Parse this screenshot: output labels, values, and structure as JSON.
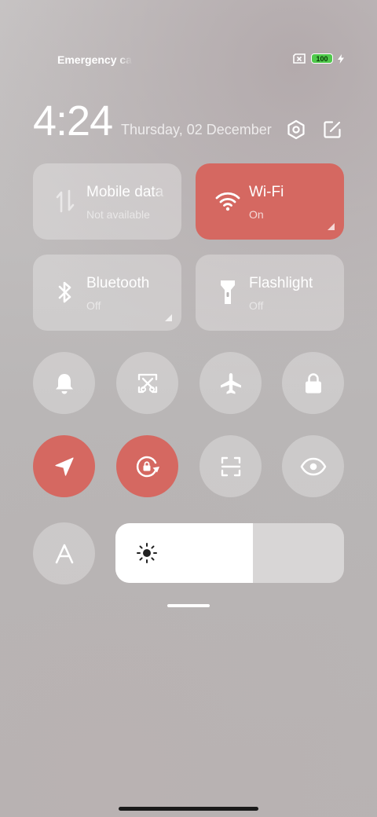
{
  "status_bar": {
    "carrier": "Emergency calls only",
    "battery_level": "100",
    "battery_color": "#4fc94b"
  },
  "header": {
    "time": "4:24",
    "date": "Thursday, 02 December"
  },
  "accent_color": "#d56861",
  "tiles": [
    {
      "label": "Mobile data",
      "status": "Not available",
      "icon": "mobile-data-icon",
      "active": false
    },
    {
      "label": "Wi-Fi",
      "status": "On",
      "icon": "wifi-icon",
      "active": true
    },
    {
      "label": "Bluetooth",
      "status": "Off",
      "icon": "bluetooth-icon",
      "active": false
    },
    {
      "label": "Flashlight",
      "status": "Off",
      "icon": "flashlight-icon",
      "active": false
    }
  ],
  "toggles": [
    {
      "icon": "bell-icon",
      "active": false
    },
    {
      "icon": "screenshot-icon",
      "active": false
    },
    {
      "icon": "airplane-icon",
      "active": false
    },
    {
      "icon": "lock-icon",
      "active": false
    },
    {
      "icon": "location-icon",
      "active": true
    },
    {
      "icon": "rotation-lock-icon",
      "active": true
    },
    {
      "icon": "scanner-icon",
      "active": false
    },
    {
      "icon": "eye-icon",
      "active": false
    },
    {
      "icon": "auto-brightness-icon",
      "active": false
    }
  ],
  "brightness": {
    "level_percent": 60,
    "icon": "sun-icon"
  }
}
